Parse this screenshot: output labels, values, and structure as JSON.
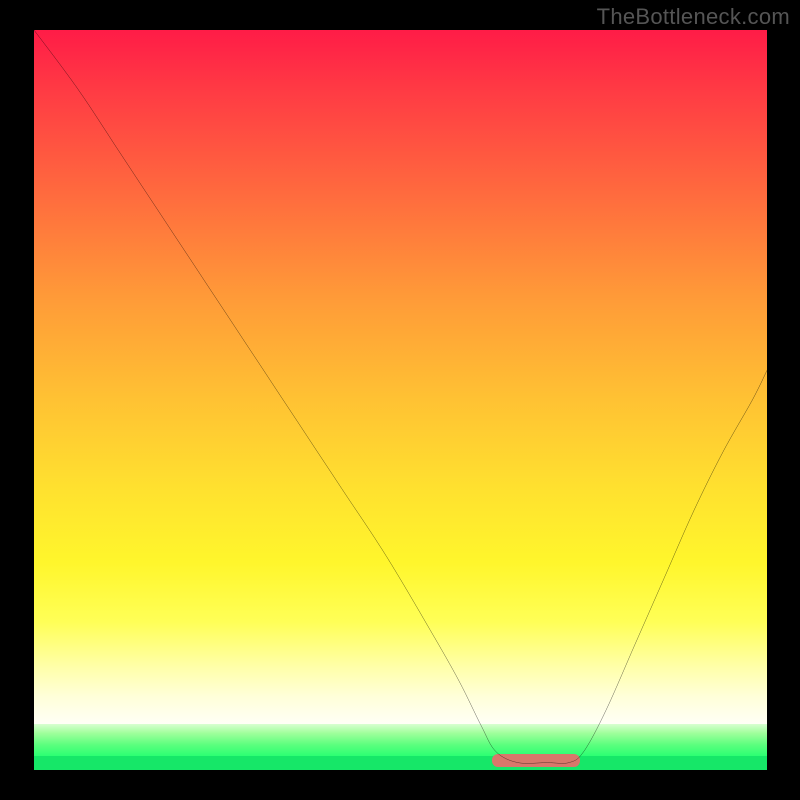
{
  "watermark": "TheBottleneck.com",
  "chart_data": {
    "type": "line",
    "title": "",
    "xlabel": "",
    "ylabel": "",
    "xlim": [
      0,
      100
    ],
    "ylim": [
      0,
      100
    ],
    "grid": false,
    "legend": false,
    "series": [
      {
        "name": "curve",
        "x": [
          0,
          6,
          12,
          18,
          24,
          30,
          36,
          42,
          48,
          54,
          58,
          61,
          63,
          66,
          70,
          73,
          75,
          78,
          82,
          86,
          90,
          94,
          98,
          100
        ],
        "values": [
          100,
          92,
          83,
          74,
          65,
          56,
          47,
          38,
          29,
          19,
          12,
          6,
          2.5,
          1.0,
          1.0,
          1.0,
          2.5,
          8,
          17,
          26,
          35,
          43,
          50,
          54
        ]
      }
    ],
    "optimal_range_x": [
      62.5,
      74.5
    ],
    "colors": {
      "gradient_top": "#ff1c47",
      "gradient_mid": "#ffe12f",
      "gradient_bottom": "#ffffd8",
      "green_band": "#2bff72",
      "green_strip": "#16e768",
      "curve": "#000000",
      "marker": "#d9776b"
    }
  }
}
